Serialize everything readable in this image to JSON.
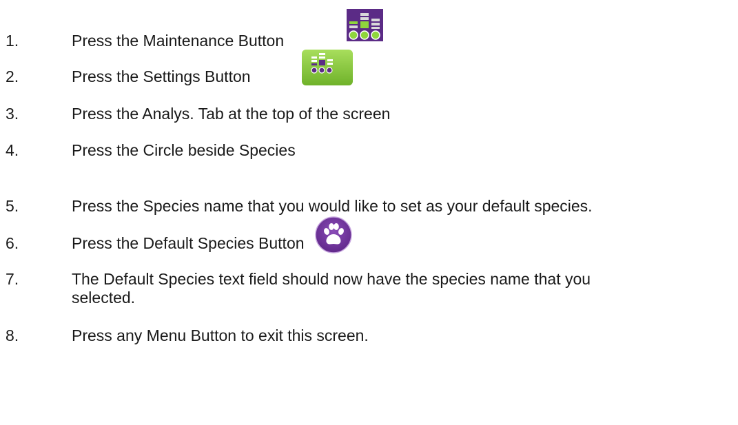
{
  "steps": [
    {
      "number": "1.",
      "text": "Press the Maintenance Button",
      "icon": "maintenance-icon"
    },
    {
      "number": "2.",
      "text": "Press the Settings Button",
      "icon": "settings-icon"
    },
    {
      "number": "3.",
      "text": "Press the Analys. Tab at the top of the screen"
    },
    {
      "number": "4.",
      "text": "Press the Circle beside Species"
    },
    {
      "number": "5.",
      "text": "Press the Species name that you would like to set as your default species."
    },
    {
      "number": "6.",
      "text": "Press the Default Species Button",
      "icon": "paw-icon"
    },
    {
      "number": "7.",
      "text": "The Default Species text field should now have the species name that you",
      "text_cont": "selected."
    },
    {
      "number": "8.",
      "text": "Press any Menu Button to exit this screen."
    }
  ],
  "colors": {
    "maintenance_bg": "#5b2b86",
    "settings_bg": "#8ccf3a",
    "paw_bg": "#6a2e95",
    "bar_green": "#8fd63c",
    "text": "#1a1a1a"
  }
}
